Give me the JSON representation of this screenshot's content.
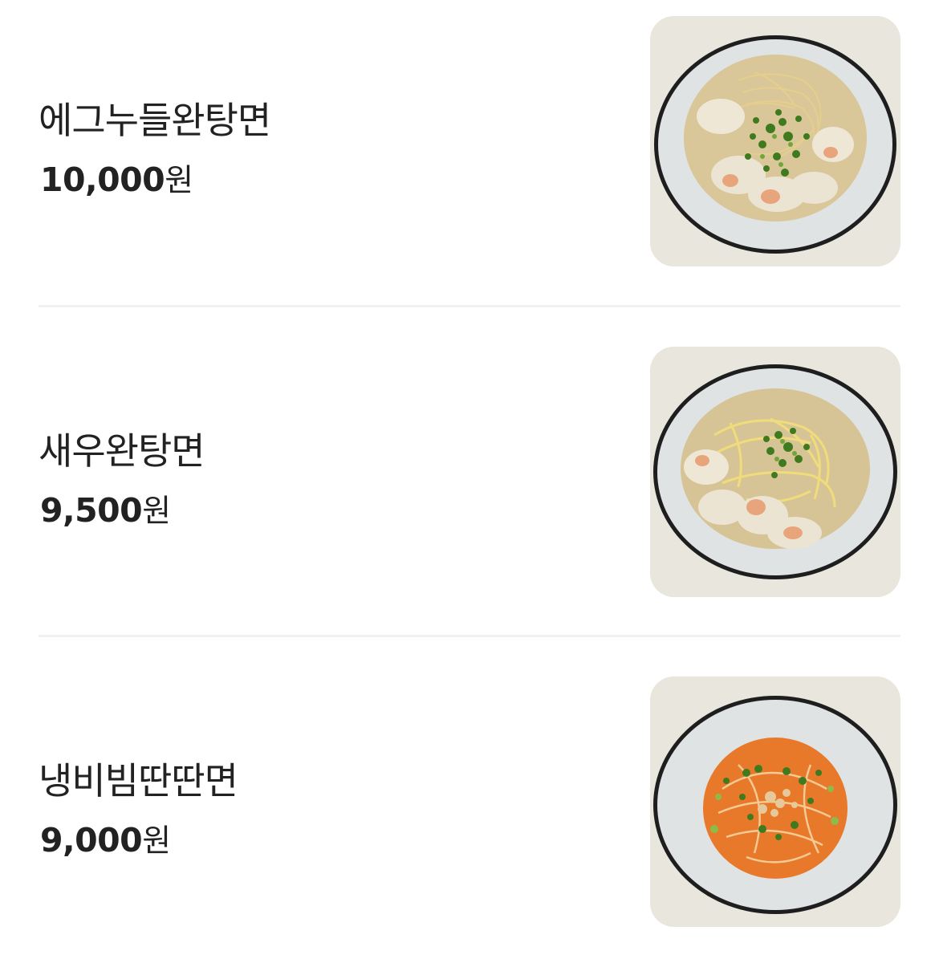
{
  "menu": {
    "items": [
      {
        "name": "에그누들완탕면",
        "price": "10,000",
        "currency": "원",
        "photo": "egg-noodle-wonton-soup"
      },
      {
        "name": "새우완탕면",
        "price": "9,500",
        "currency": "원",
        "photo": "shrimp-wonton-noodle-soup"
      },
      {
        "name": "냉비빔딴딴면",
        "price": "9,000",
        "currency": "원",
        "photo": "cold-bibim-dandan-noodles"
      }
    ]
  },
  "colors": {
    "text": "#222222",
    "divider": "#f1f1f1",
    "photo_background": "#e9e6dd",
    "bowl_rim": "#1e1e1e",
    "broth": "#d9c79a",
    "chili_sauce": "#e8792a",
    "scallion": "#3f7a1e"
  }
}
